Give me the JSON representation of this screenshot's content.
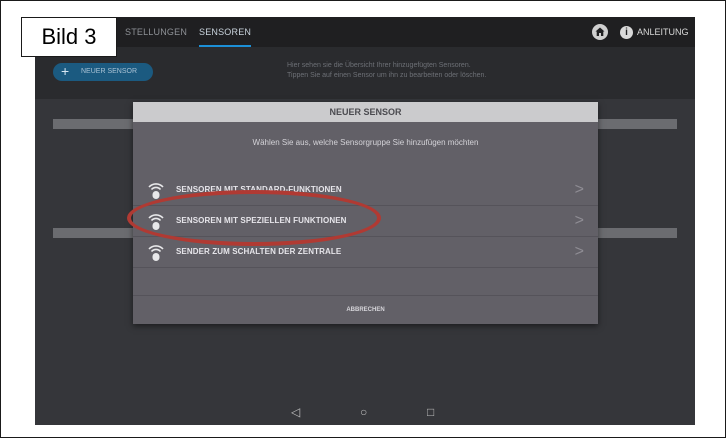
{
  "caption": "Bild 3",
  "tabs": [
    {
      "label": "STELLUNGEN",
      "active": false
    },
    {
      "label": "SENSOREN",
      "active": true
    }
  ],
  "header": {
    "help_label": "ANLEITUNG",
    "home_icon": "home-icon",
    "info_icon": "info-icon"
  },
  "toolbar": {
    "new_sensor_label": "NEUER SENSOR",
    "info_line1": "Hier sehen sie die Übersicht Ihrer hinzugefügten Sensoren.",
    "info_line2": "Tippen Sie auf einen Sensor um ihn zu bearbeiten oder löschen."
  },
  "dialog": {
    "title": "NEUER SENSOR",
    "subtitle": "Wählen Sie aus, welche Sensorgruppe Sie hinzufügen möchten",
    "options": [
      {
        "label": "SENSOREN MIT STANDARD-FUNKTIONEN",
        "icon": "wireless-icon"
      },
      {
        "label": "SENSOREN MIT SPEZIELLEN FUNKTIONEN",
        "icon": "wireless-icon"
      },
      {
        "label": "SENDER ZUM SCHALTEN DER ZENTRALE",
        "icon": "wireless-icon"
      }
    ],
    "cancel_label": "ABBRECHEN"
  },
  "navbar": {
    "back": "◁",
    "home": "○",
    "recents": "□"
  },
  "colors": {
    "accent": "#1c8fd6",
    "highlight_ring": "#b03a33",
    "dialog_bg": "#626067",
    "screen_bg": "#35363a"
  }
}
